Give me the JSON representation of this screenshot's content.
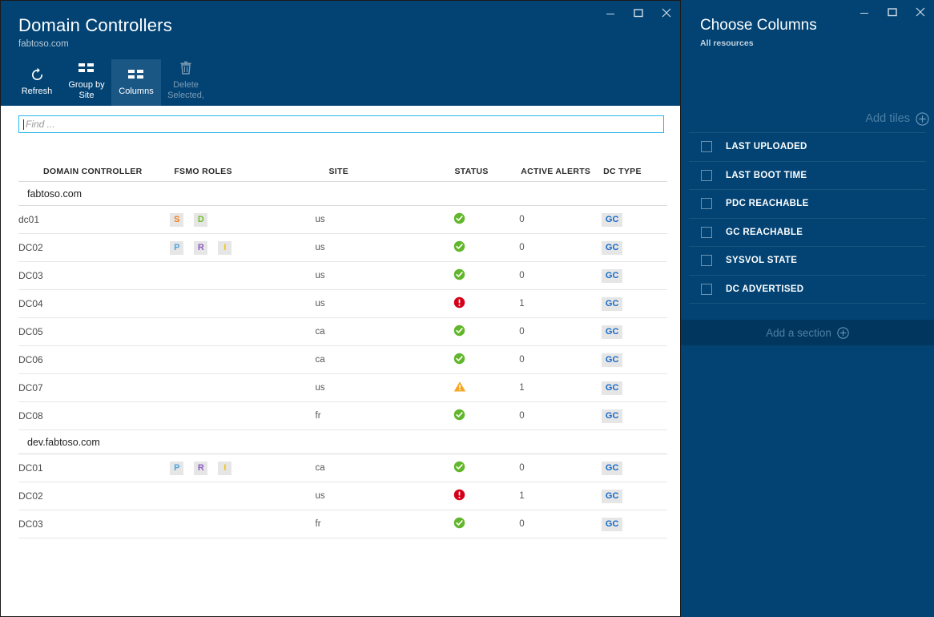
{
  "left_window": {
    "title": "Domain Controllers",
    "subtitle": "fabtoso.com",
    "window_controls": {
      "minimize": "minimize-icon",
      "maximize": "maximize-icon",
      "close": "close-icon"
    },
    "toolbar": [
      {
        "label": "Refresh",
        "icon": "refresh-icon",
        "state": "enabled"
      },
      {
        "label": "Group by\nSite",
        "icon": "columns-grid-icon",
        "state": "enabled"
      },
      {
        "label": "Columns",
        "icon": "columns-grid-icon",
        "state": "active"
      },
      {
        "label": "Delete\nSelected,",
        "icon": "trash-icon",
        "state": "disabled"
      }
    ],
    "search": {
      "placeholder": "Find ...",
      "value": ""
    },
    "table": {
      "headers": [
        "DOMAIN CONTROLLER",
        "FSMO ROLES",
        "SITE",
        "STATUS",
        "ACTIVE ALERTS",
        "DC TYPE"
      ],
      "groups": [
        {
          "name": "fabtoso.com",
          "rows": [
            {
              "dc": "dc01",
              "fsmo": [
                "S",
                "D"
              ],
              "site": "us",
              "status": "ok",
              "alerts": "0",
              "type": "GC"
            },
            {
              "dc": "DC02",
              "fsmo": [
                "P",
                "R",
                "I"
              ],
              "site": "us",
              "status": "ok",
              "alerts": "0",
              "type": "GC"
            },
            {
              "dc": "DC03",
              "fsmo": [],
              "site": "us",
              "status": "ok",
              "alerts": "0",
              "type": "GC"
            },
            {
              "dc": "DC04",
              "fsmo": [],
              "site": "us",
              "status": "error",
              "alerts": "1",
              "type": "GC"
            },
            {
              "dc": "DC05",
              "fsmo": [],
              "site": "ca",
              "status": "ok",
              "alerts": "0",
              "type": "GC"
            },
            {
              "dc": "DC06",
              "fsmo": [],
              "site": "ca",
              "status": "ok",
              "alerts": "0",
              "type": "GC"
            },
            {
              "dc": "DC07",
              "fsmo": [],
              "site": "us",
              "status": "warning",
              "alerts": "1",
              "type": "GC"
            },
            {
              "dc": "DC08",
              "fsmo": [],
              "site": "fr",
              "status": "ok",
              "alerts": "0",
              "type": "GC"
            }
          ]
        },
        {
          "name": "dev.fabtoso.com",
          "rows": [
            {
              "dc": "DC01",
              "fsmo": [
                "P",
                "R",
                "I"
              ],
              "site": "ca",
              "status": "ok",
              "alerts": "0",
              "type": "GC"
            },
            {
              "dc": "DC02",
              "fsmo": [],
              "site": "us",
              "status": "error",
              "alerts": "1",
              "type": "GC"
            },
            {
              "dc": "DC03",
              "fsmo": [],
              "site": "fr",
              "status": "ok",
              "alerts": "0",
              "type": "GC"
            }
          ]
        }
      ]
    }
  },
  "right_window": {
    "title": "Choose Columns",
    "subtitle": "All resources",
    "window_controls": {
      "minimize": "minimize-icon",
      "maximize": "maximize-icon",
      "close": "close-icon"
    },
    "add_tiles_label": "Add tiles",
    "add_section_label": "Add a section",
    "columns": [
      {
        "label": "LAST UPLOADED",
        "checked": false
      },
      {
        "label": "LAST BOOT TIME",
        "checked": false
      },
      {
        "label": "PDC REACHABLE",
        "checked": false
      },
      {
        "label": "GC REACHABLE",
        "checked": false
      },
      {
        "label": "SYSVOL STATE",
        "checked": false
      },
      {
        "label": "DC ADVERTISED",
        "checked": false
      }
    ]
  },
  "colors": {
    "brand_blue": "#024374",
    "panel_dark_blue": "#01375e",
    "active_tool_blue": "#1b5785",
    "search_border": "#2bb8e8",
    "status_ok": "#62b62b",
    "status_error": "#d4001a",
    "status_warning": "#f5a623",
    "gc_text": "#1569c7",
    "fsmo_S": "#f07c1a",
    "fsmo_D": "#6fbe2a",
    "fsmo_P": "#4da3e0",
    "fsmo_R": "#8e5fbf",
    "fsmo_I": "#f0c419"
  }
}
